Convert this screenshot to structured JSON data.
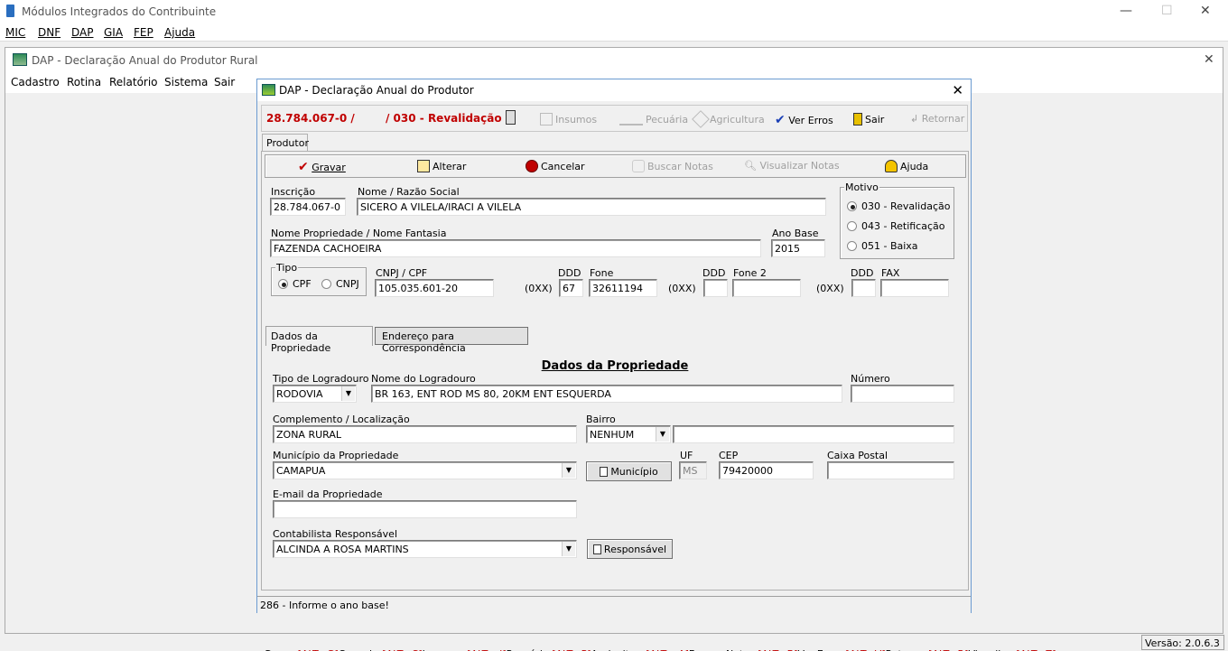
{
  "app": {
    "title": "Módulos Integrados do Contribuinte",
    "menu": [
      "MIC",
      "DNF",
      "DAP",
      "GIA",
      "FEP",
      "Ajuda"
    ],
    "version": "Versão: 2.0.6.3"
  },
  "child": {
    "title": "DAP - Declaração Anual do Produtor Rural",
    "menu": [
      "Cadastro",
      "Rotina",
      "Relatório",
      "Sistema",
      "Sair"
    ]
  },
  "dialog": {
    "title": "DAP  - Declaração Anual do Produtor",
    "header_inscricao": "28.784.067-0  /",
    "header_motivo": "/ 030 - Revalidação",
    "toolbar": {
      "insumos": "Insumos",
      "pecuaria": "Pecuária",
      "agricultura": "Agricultura",
      "ver_erros": "Ver Erros",
      "sair": "Sair",
      "retornar": "Retornar"
    },
    "outer_tab": "Produtor",
    "actions": {
      "gravar": "Gravar",
      "alterar": "Alterar",
      "cancelar": "Cancelar",
      "buscar_notas": "Buscar Notas",
      "visualizar_notas": "Visualizar Notas",
      "ajuda": "Ajuda"
    },
    "form": {
      "inscricao_label": "Inscrição",
      "inscricao": "28.784.067-0",
      "nome_label": "Nome / Razão Social",
      "nome": "SICERO A VILELA/IRACI A VILELA",
      "motivo_label": "Motivo",
      "motivo_options": [
        "030 - Revalidação",
        "043 - Retificação",
        "051 - Baixa"
      ],
      "propriedade_label": "Nome Propriedade / Nome Fantasia",
      "propriedade": "FAZENDA CACHOEIRA",
      "ano_base_label": "Ano Base",
      "ano_base": "2015",
      "tipo_label": "Tipo",
      "tipo_cpf": "CPF",
      "tipo_cnpj": "CNPJ",
      "cnpj_cpf_label": "CNPJ / CPF",
      "cnpj_cpf": "105.035.601-20",
      "ddd_label": "DDD",
      "ddd_prefix": "(0XX)",
      "ddd": "67",
      "fone_label": "Fone",
      "fone": "32611194",
      "fone2_label": "Fone 2",
      "fax_label": "FAX"
    },
    "inner_tabs": [
      "Dados da Propriedade",
      "Endereço para Correspondência"
    ],
    "section_title": "Dados da Propriedade",
    "prop": {
      "tipo_logradouro_label": "Tipo de Logradouro",
      "tipo_logradouro": "RODOVIA",
      "nome_logradouro_label": "Nome do Logradouro",
      "nome_logradouro": "BR 163, ENT ROD MS 80, 20KM ENT ESQUERDA",
      "numero_label": "Número",
      "complemento_label": "Complemento / Localização",
      "complemento": "ZONA RURAL",
      "bairro_label": "Bairro",
      "bairro": "NENHUM",
      "municipio_label": "Município da Propriedade",
      "municipio": "CAMAPUA",
      "municipio_btn": "Município",
      "uf_label": "UF",
      "uf": "MS",
      "cep_label": "CEP",
      "cep": "79420000",
      "caixa_postal_label": "Caixa Postal",
      "email_label": "E-mail da Propriedade",
      "contabilista_label": "Contabilista Responsável",
      "contabilista": "ALCINDA A ROSA MARTINS",
      "responsavel_btn": "Responsável"
    },
    "shortcuts": [
      {
        "name": "Gravar",
        "key": "[ALT+G]"
      },
      {
        "name": "Cancelar",
        "key": "[ALT+C]"
      },
      {
        "name": "Insumos ",
        "key": "[ALT+ I]"
      },
      {
        "name": "Pecuária ",
        "key": "[ALT+P]"
      },
      {
        "name": "Agricultura",
        "key": "[ALT+ A]"
      },
      {
        "name": "Buscar Notas ",
        "key": "[ALT+B]"
      },
      {
        "name": "Ver Erros ",
        "key": "[ALT+V]"
      },
      {
        "name": "Retornar",
        "key": "[ALT+R]"
      },
      {
        "name": "Visualizar",
        "key": "[ALT+Z]"
      }
    ],
    "status": "286 - Informe o ano base!"
  }
}
